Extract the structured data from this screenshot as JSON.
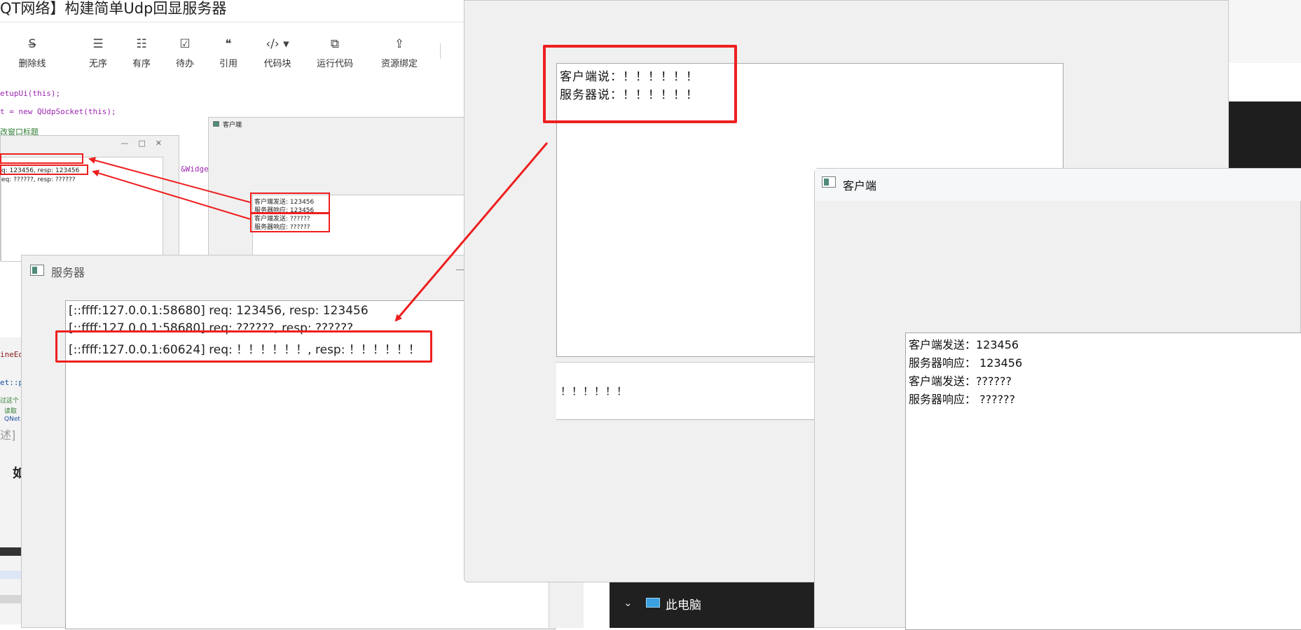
{
  "editor": {
    "doc_title": "QT网络】构建简单Udp回显服务器",
    "toolbar": [
      "删除线",
      "无序",
      "有序",
      "待办",
      "引用",
      "代码块",
      "运行代码",
      "资源绑定"
    ],
    "code_lines": [
      "etupUi(this);",
      "t = new QUdpSocket(this);",
      "改窗口标题",
      "&Widge"
    ],
    "side_snippets": [
      "ineEd",
      "et::p",
      "过这个",
      "读取",
      "QNet",
      "述]",
      "如"
    ]
  },
  "mini_server_window": {
    "lines": [
      "q: 123456, resp: 123456",
      "eq: ??????, resp: ??????"
    ]
  },
  "mini_client_window": {
    "title": "客户端",
    "lines": [
      "客户端发送: 123456",
      "服务器响应: 123456",
      "客户端发送: ??????",
      "服务器响应: ??????"
    ]
  },
  "server_window": {
    "title": "服务器",
    "log": [
      "[::ffff:127.0.0.1:58680] req: 123456, resp: 123456",
      "[::ffff:127.0.0.1:58680] req: ??????, resp: ??????",
      "[::ffff:127.0.0.1:60624] req: ！！！！！！, resp: ！！！！！！"
    ]
  },
  "chat_window": {
    "messages": [
      "客户端说：！！！！！！",
      "服务器说：！！！！！！"
    ],
    "input_value": "！！！！！！"
  },
  "client_window": {
    "title": "客户端",
    "lines": [
      "客户端发送：123456",
      "服务器响应： 123456",
      "客户端发送：??????",
      "服务器响应： ??????"
    ]
  },
  "explorer": {
    "this_pc_label": "此电脑"
  },
  "colors": {
    "annotation_red": "#ee1f1f",
    "window_bg": "#f0f0f0",
    "dark_bg": "#1e1e1e"
  }
}
